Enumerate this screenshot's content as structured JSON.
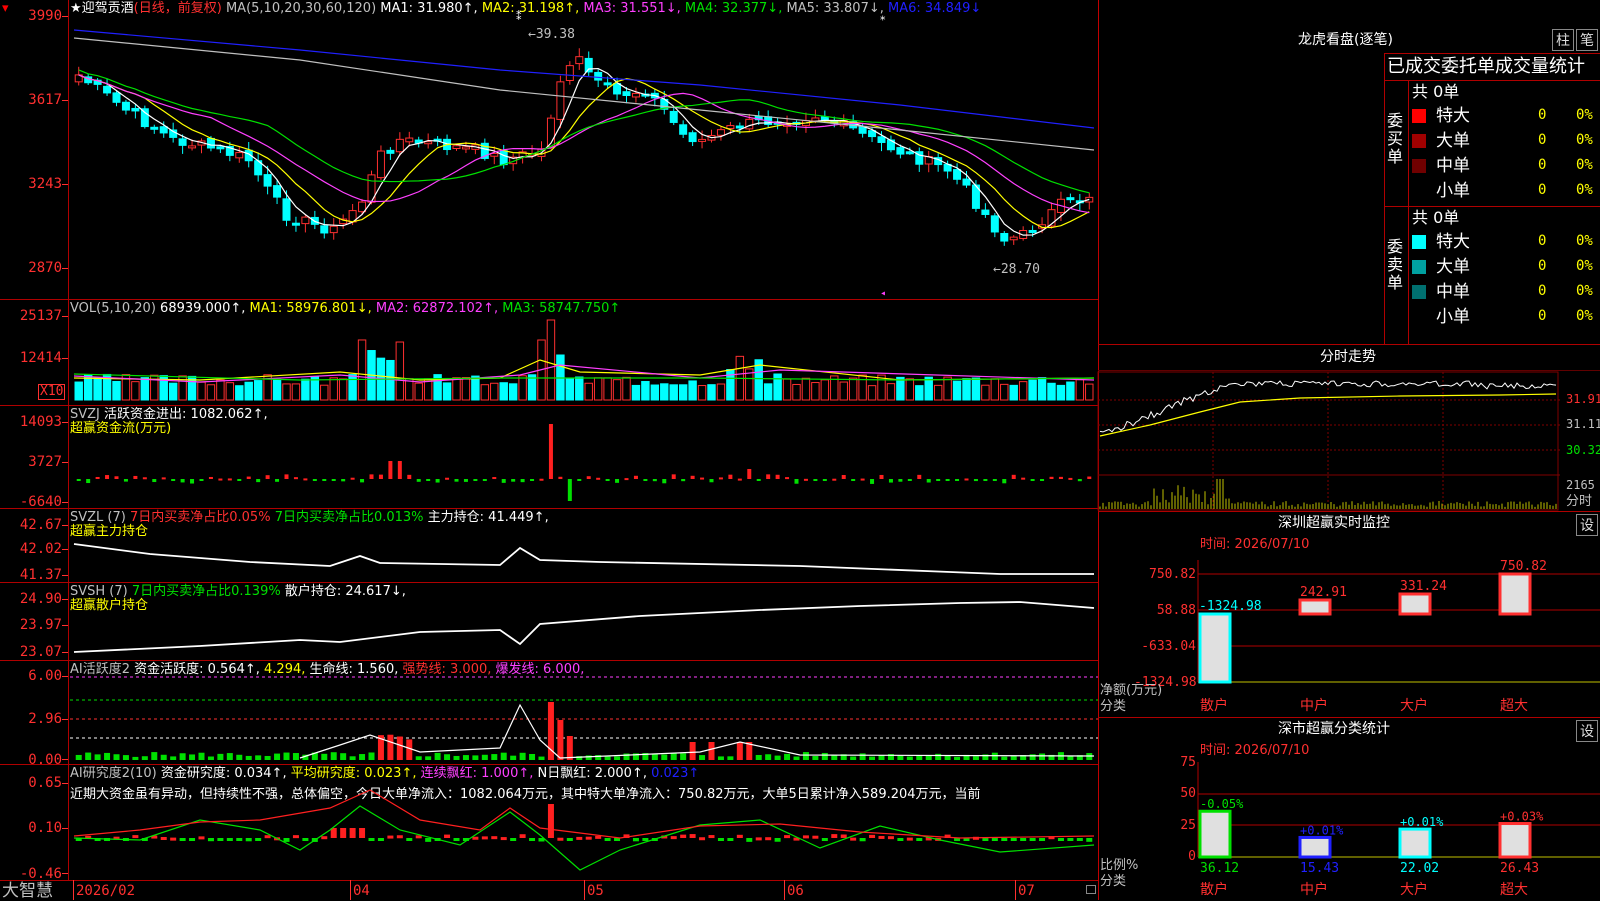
{
  "title": {
    "star": "★",
    "name": "迎驾贡酒",
    "period": "(日线，前复权)"
  },
  "ma_legend": [
    {
      "t": "MA(5,10,20,30,60,120)",
      "c": "#c0c0c0"
    },
    {
      "t": "MA1: 31.980↑,",
      "c": "#ffffff"
    },
    {
      "t": "MA2: 31.198↑,",
      "c": "#ffff00"
    },
    {
      "t": "MA3: 31.551↓,",
      "c": "#ff40ff"
    },
    {
      "t": "MA4: 32.377↓,",
      "c": "#00e000"
    },
    {
      "t": "MA5: 33.807↓,",
      "c": "#c0c0c0"
    },
    {
      "t": "MA6: 34.849↓",
      "c": "#2020ff"
    }
  ],
  "price_axis": [
    "3990",
    "3617",
    "3243",
    "2870"
  ],
  "price_annot": {
    "high": "39.38",
    "low": "28.70"
  },
  "vol_legend": [
    {
      "t": "VOL(5,10,20)",
      "c": "#c0c0c0"
    },
    {
      "t": "68939.000↑,",
      "c": "#ffffff"
    },
    {
      "t": "MA1: 58976.801↓,",
      "c": "#ffff00"
    },
    {
      "t": "MA2: 62872.102↑,",
      "c": "#ff40ff"
    },
    {
      "t": "MA3: 58747.750↑",
      "c": "#00e000"
    }
  ],
  "vol_axis": [
    "25137",
    "12414"
  ],
  "vol_unit": "X10",
  "svzj": {
    "legend": [
      {
        "t": "SVZJ",
        "c": "#c0c0c0"
      },
      {
        "t": "活跃资金进出: 1082.062↑,",
        "c": "#ffffff"
      }
    ],
    "sub": "超赢资金流(万元)",
    "axis": [
      "14093",
      "3727",
      "-6640"
    ]
  },
  "svzl": {
    "legend": [
      {
        "t": "SVZL (7)",
        "c": "#c0c0c0"
      },
      {
        "t": "7日内买卖净占比0.05%",
        "c": "#ff3030"
      },
      {
        "t": "7日内买卖净占比0.013%",
        "c": "#00e000"
      },
      {
        "t": "主力持仓: 41.449↑,",
        "c": "#ffffff"
      }
    ],
    "sub": "超赢主力持仓",
    "axis": [
      "42.67",
      "42.02",
      "41.37"
    ]
  },
  "svsh": {
    "legend": [
      {
        "t": "SVSH (7)",
        "c": "#c0c0c0"
      },
      {
        "t": "7日内买卖净占比0.139%",
        "c": "#00e000"
      },
      {
        "t": "散户持仓: 24.617↓,",
        "c": "#ffffff"
      }
    ],
    "sub": "超赢散户持仓",
    "axis": [
      "24.90",
      "23.97",
      "23.07"
    ]
  },
  "ai2": {
    "legend": [
      {
        "t": "AI活跃度2",
        "c": "#c0c0c0"
      },
      {
        "t": "资金活跃度: 0.564↑,",
        "c": "#ffffff"
      },
      {
        "t": "4.294,",
        "c": "#ffff00"
      },
      {
        "t": "生命线: 1.560,",
        "c": "#ffffff"
      },
      {
        "t": "强势线: 3.000,",
        "c": "#ff3030"
      },
      {
        "t": "爆发线: 6.000,",
        "c": "#ff40ff"
      }
    ],
    "axis": [
      "6.00",
      "2.96",
      "0.00"
    ]
  },
  "ai3": {
    "legend": [
      {
        "t": "AI研究度2(10)",
        "c": "#c0c0c0"
      },
      {
        "t": "资金研究度: 0.034↑,",
        "c": "#ffffff"
      },
      {
        "t": "平均研究度: 0.023↑,",
        "c": "#ffff00"
      },
      {
        "t": "连续飘红: 1.000↑,",
        "c": "#ff40ff"
      },
      {
        "t": "N日飘红: 2.000↑,",
        "c": "#ffffff"
      },
      {
        "t": "0.023↑",
        "c": "#2020ff"
      }
    ],
    "note": "近期大资金虽有异动，但持续性不强，总体偏空，今日大单净流入：1082.064万元，其中特大单净流入：750.82万元，大单5日累计净入589.204万元，当前",
    "axis": [
      "0.65",
      "0.10",
      "-0.46"
    ]
  },
  "date_axis": [
    "2026/02",
    "04",
    "05",
    "06",
    "07"
  ],
  "brand": "大智慧",
  "right": {
    "lhb_title": "龙虎看盘(逐笔)",
    "btn1": "柱",
    "btn2": "笔",
    "stat_title": "已成交委托单成交量统计",
    "buy": {
      "label": "委买单",
      "count": "共 0单",
      "rows": [
        {
          "n": "特大",
          "v": "0",
          "p": "0%",
          "c": "#ff0000"
        },
        {
          "n": "大单",
          "v": "0",
          "p": "0%",
          "c": "#a00000"
        },
        {
          "n": "中单",
          "v": "0",
          "p": "0%",
          "c": "#700000"
        },
        {
          "n": "小单",
          "v": "0",
          "p": "0%",
          "c": "#000000"
        }
      ]
    },
    "sell": {
      "label": "委卖单",
      "count": "共 0单",
      "rows": [
        {
          "n": "特大",
          "v": "0",
          "p": "0%",
          "c": "#00ffff"
        },
        {
          "n": "大单",
          "v": "0",
          "p": "0%",
          "c": "#00a0a0"
        },
        {
          "n": "中单",
          "v": "0",
          "p": "0%",
          "c": "#007070"
        },
        {
          "n": "小单",
          "v": "0",
          "p": "0%",
          "c": "#000000"
        }
      ]
    },
    "fs_title": "分时走势",
    "fs_axis": [
      "31.91",
      "31.11",
      "30.32",
      "2165"
    ],
    "fs_unit": "分时",
    "mon_title": "深圳超赢实时监控",
    "mon_btn": "设",
    "mon_time": "时间: 2026/07/10",
    "mon_axis": [
      "750.82",
      "58.88",
      "-633.04",
      "-1324.98"
    ],
    "mon_ylabel": "净额(万元)",
    "mon_xlabel": "分类",
    "mon_cats": [
      "散户",
      "中户",
      "大户",
      "超大"
    ],
    "mon_vals": [
      "-1324.98",
      "242.91",
      "331.24",
      "750.82"
    ],
    "cls_title": "深市超赢分类统计",
    "cls_btn": "设",
    "cls_time": "时间: 2026/07/10",
    "cls_axis": [
      "75",
      "50",
      "25",
      "0"
    ],
    "cls_ylabel": "比例%",
    "cls_xlabel": "分类",
    "cls_cats": [
      "散户",
      "中户",
      "大户",
      "超大"
    ],
    "cls_vals": [
      "36.12",
      "15.43",
      "22.02",
      "26.43"
    ],
    "cls_chg": [
      "-0.05%",
      "+0.01%",
      "+0.01%",
      "+0.03%"
    ]
  }
}
